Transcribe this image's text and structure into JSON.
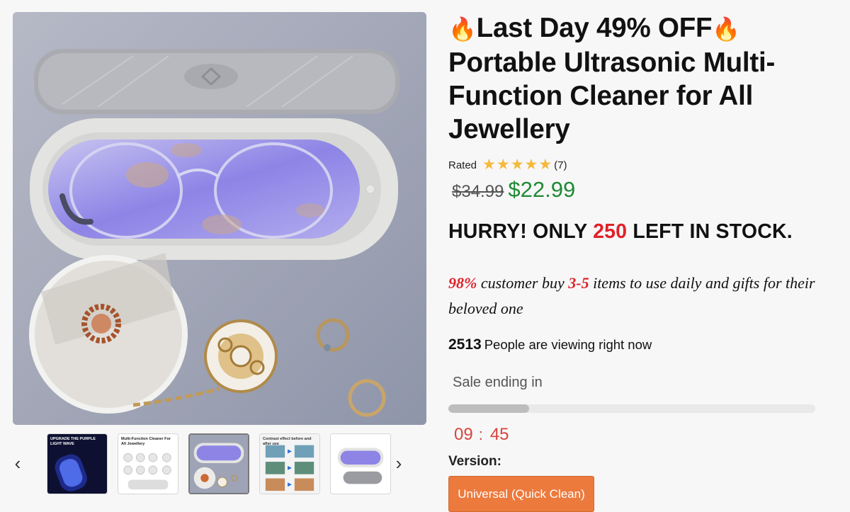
{
  "product": {
    "title_emoji_left": "🔥",
    "title_emoji_right": "🔥",
    "title_promo": "Last Day 49% OFF",
    "title_name": "Portable Ultrasonic Multi-Function Cleaner for All Jewellery",
    "rating_label": "Rated",
    "rating_stars": 5,
    "rating_count": "(7)",
    "old_price": "$34.99",
    "new_price": "$22.99"
  },
  "stock": {
    "prefix": "HURRY! ONLY",
    "count": "250",
    "suffix": "LEFT IN STOCK."
  },
  "promo_line": {
    "percent": "98%",
    "text1": "customer buy",
    "range": "3-5",
    "text2": "items to use daily and gifts for their beloved one"
  },
  "viewers": {
    "count": "2513",
    "text": "People are viewing right now"
  },
  "sale": {
    "label": "Sale ending in",
    "progress_fraction": 0.22,
    "minutes": "09",
    "separator": ":",
    "seconds": "45"
  },
  "version": {
    "label": "Version:",
    "selected": "Universal (Quick Clean)"
  },
  "gallery": {
    "prev_icon": "‹",
    "next_icon": "›",
    "thumbs": [
      {
        "caption": "UPGRADE THE PURPLE LIGHT WAVE"
      },
      {
        "caption": "Multi-Function Cleaner For All Jewellery"
      },
      {
        "caption": ""
      },
      {
        "caption": "Contrast effect before and after use"
      },
      {
        "caption": ""
      }
    ]
  },
  "colors": {
    "accent_button": "#ec7a3d",
    "price_green": "#1f8a35",
    "alert_red": "#e0222a",
    "star": "#f5b93a"
  }
}
